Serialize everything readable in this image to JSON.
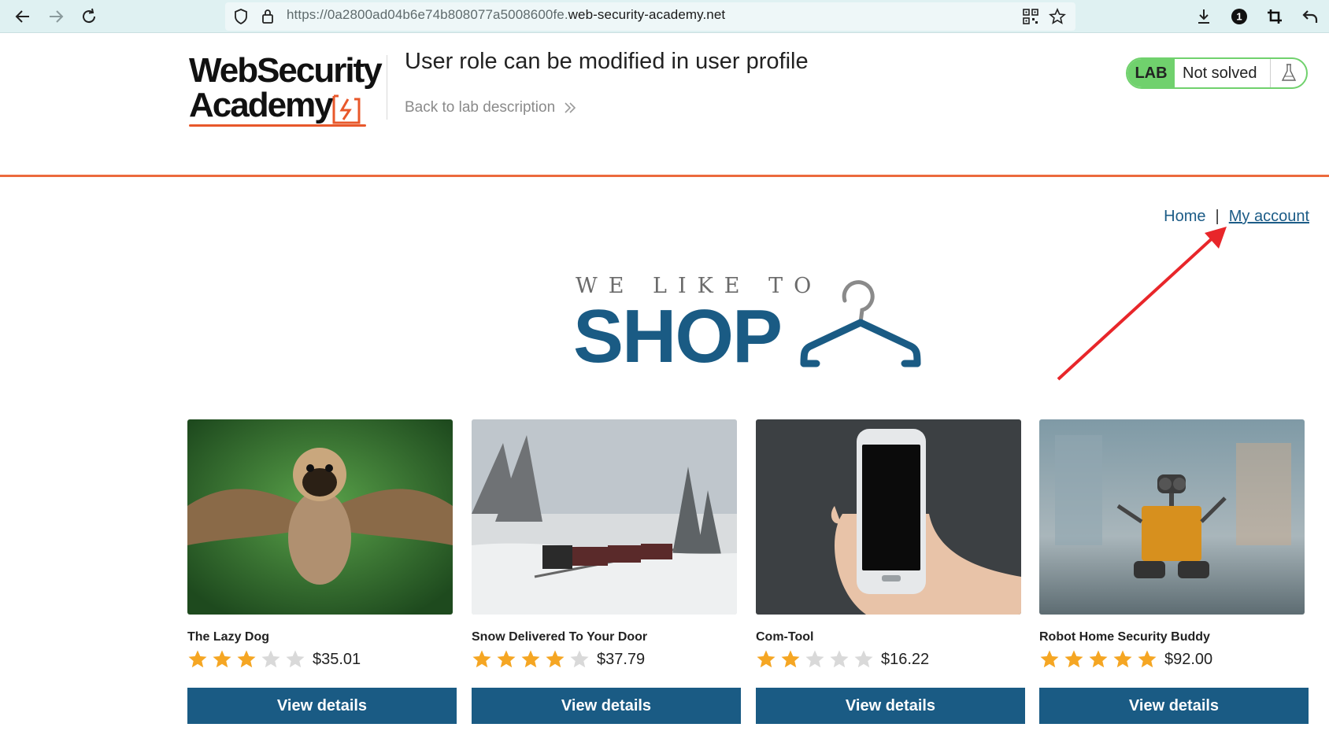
{
  "browser": {
    "url_prefix": "https://0a2800ad04b6e74b808077a5008600fe.",
    "url_domain": "web-security-academy.net",
    "icons": [
      "back-arrow-icon",
      "forward-arrow-icon",
      "reload-icon",
      "shield-icon",
      "lock-icon",
      "qr-code-icon",
      "bookmark-star-icon",
      "download-icon",
      "extension-icon",
      "crop-icon",
      "undo-icon"
    ],
    "extension_badge": "1"
  },
  "lab": {
    "logo_line1": "WebSecurity",
    "logo_line2": "Academy",
    "title": "User role can be modified in user profile",
    "back_link": "Back to lab description",
    "badge_label": "LAB",
    "badge_status": "Not solved",
    "accent_color": "#ec6a3d",
    "status_color": "#70d16d"
  },
  "nav": {
    "home": "Home",
    "separator": "|",
    "my_account": "My account"
  },
  "banner": {
    "small_text": "WE LIKE TO",
    "big_text": "SHOP"
  },
  "products": [
    {
      "name": "The Lazy Dog",
      "rating": 3,
      "max_rating": 5,
      "price": "$35.01",
      "button": "View details"
    },
    {
      "name": "Snow Delivered To Your Door",
      "rating": 4,
      "max_rating": 5,
      "price": "$37.79",
      "button": "View details"
    },
    {
      "name": "Com-Tool",
      "rating": 2,
      "max_rating": 5,
      "price": "$16.22",
      "button": "View details"
    },
    {
      "name": "Robot Home Security Buddy",
      "rating": 5,
      "max_rating": 5,
      "price": "$92.00",
      "button": "View details"
    }
  ],
  "colors": {
    "brand_blue": "#1a5b84",
    "star_filled": "#f5a623",
    "star_empty": "#d9d9d9",
    "annotation_red": "#e8262a"
  }
}
